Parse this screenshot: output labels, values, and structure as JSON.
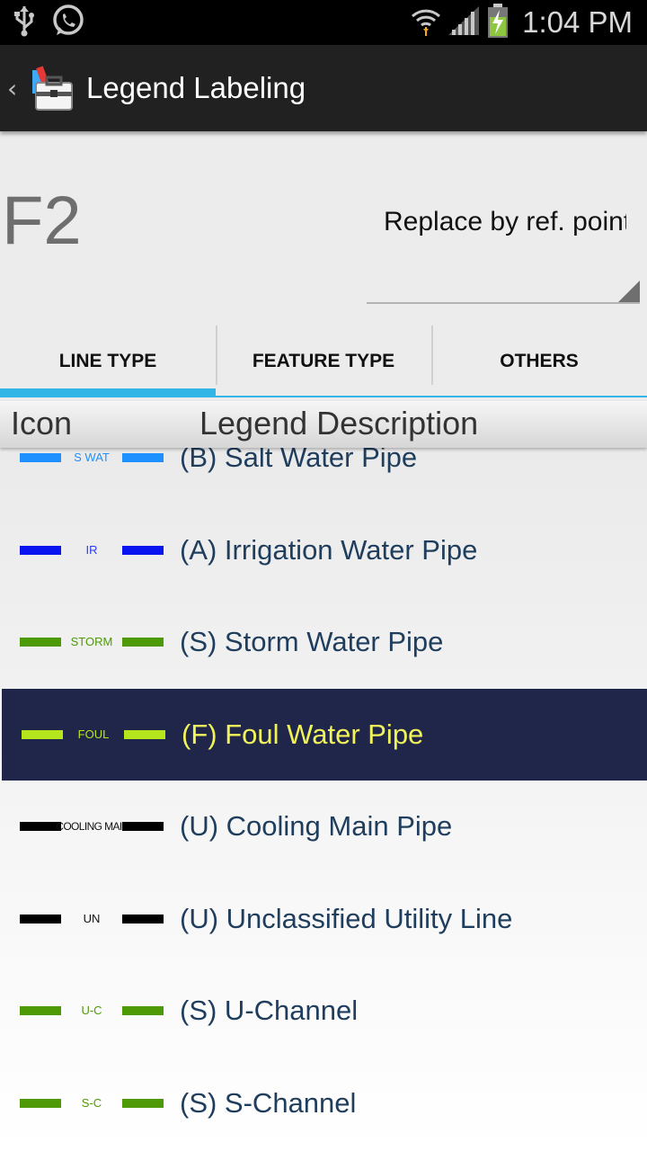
{
  "status_bar": {
    "time": "1:04 PM",
    "left_icons": [
      "usb-icon",
      "whatsapp-icon"
    ],
    "right_icons": [
      "wifi-icon",
      "signal-icon",
      "battery-charging-icon"
    ]
  },
  "action_bar": {
    "title": "Legend Labeling",
    "app_icon": "toolbox-icon"
  },
  "header": {
    "code": "F2",
    "replace_select_value": "Replace by ref. point"
  },
  "tabs": [
    {
      "label": "LINE TYPE",
      "active": true
    },
    {
      "label": "FEATURE TYPE",
      "active": false
    },
    {
      "label": "OTHERS",
      "active": false
    }
  ],
  "columns": {
    "icon": "Icon",
    "description": "Legend Description"
  },
  "legend_items": [
    {
      "icon_text": "S WAT",
      "color": "#1e90ff",
      "text_color": "#1e90ff",
      "description": "(B) Salt Water Pipe"
    },
    {
      "icon_text": "IR",
      "color": "#0a14f0",
      "text_color": "#2a3af0",
      "description": "(A) Irrigation Water Pipe"
    },
    {
      "icon_text": "STORM",
      "color": "#4e9a06",
      "text_color": "#4e9a06",
      "description": "(S) Storm Water Pipe"
    },
    {
      "icon_text": "FOUL",
      "color": "#b5e61d",
      "text_color": "#b5e61d",
      "description": "(F) Foul Water Pipe",
      "selected": true
    },
    {
      "icon_text": "COOLING MAIN",
      "color": "#000000",
      "text_color": "#111111",
      "description": "(U) Cooling Main Pipe"
    },
    {
      "icon_text": "UN",
      "color": "#000000",
      "text_color": "#111111",
      "description": "(U) Unclassified Utility Line"
    },
    {
      "icon_text": "U-C",
      "color": "#4e9a06",
      "text_color": "#4e9a06",
      "description": "(S) U-Channel"
    },
    {
      "icon_text": "S-C",
      "color": "#4e9a06",
      "text_color": "#4e9a06",
      "description": "(S) S-Channel"
    }
  ],
  "colors": {
    "accent": "#33b5e5",
    "selected_bg": "#1f264a",
    "selected_text": "#f1f35a",
    "row_text": "#1f3d5c"
  }
}
